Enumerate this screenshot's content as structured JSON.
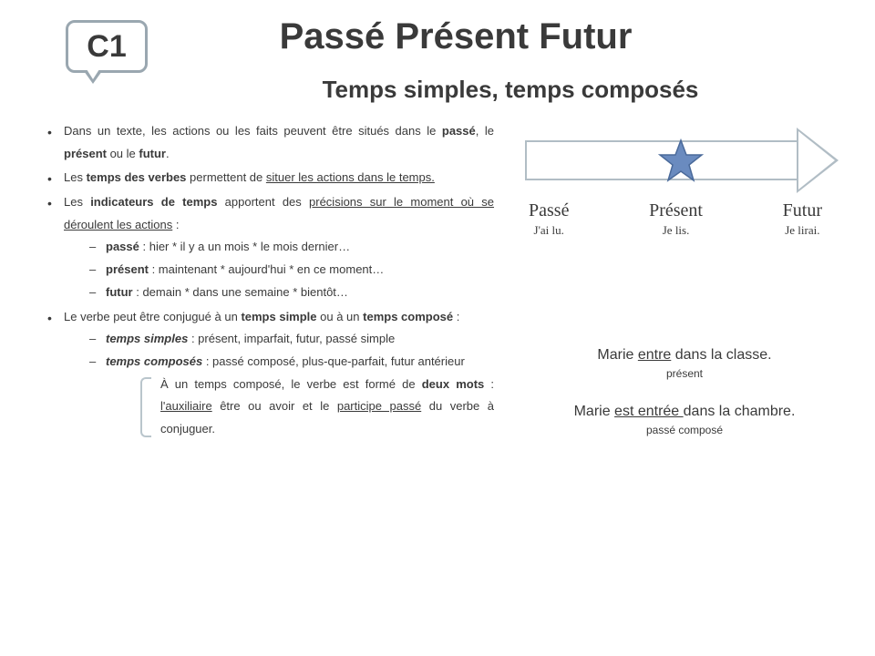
{
  "badge": "C1",
  "title": "Passé Présent Futur",
  "subtitle": "Temps simples, temps composés",
  "bullets": {
    "b1_a": "Dans un texte, les actions ou les faits peuvent être situés dans le ",
    "b1_p": "passé",
    "b1_b": ", le ",
    "b1_pr": "présent",
    "b1_c": " ou le ",
    "b1_f": "futur",
    "b1_d": ".",
    "b2_a": "Les ",
    "b2_t": "temps des verbes",
    "b2_b": " permettent de ",
    "b2_u": "situer les actions dans le temps.",
    "b3_a": "Les ",
    "b3_i": "indicateurs de temps",
    "b3_b": " apportent des ",
    "b3_u": "précisions sur le moment où se déroulent les actions",
    "b3_c": " :",
    "s1_k": "passé",
    "s1_v": " : hier * il y a un mois * le mois dernier…",
    "s2_k": "présent",
    "s2_v": " : maintenant * aujourd'hui * en ce moment…",
    "s3_k": "futur",
    "s3_v": " : demain * dans une semaine * bientôt…",
    "b4_a": "Le verbe peut être conjugué à un ",
    "b4_ts": "temps simple",
    "b4_b": " ou à un ",
    "b4_tc": "temps composé",
    "b4_c": " :",
    "s4_k": "temps simples",
    "s4_v": " : présent, imparfait, futur, passé simple",
    "s5_k": "temps composés",
    "s5_v": " : passé composé, plus-que-parfait, futur antérieur",
    "note_a": "À un temps composé, le verbe est formé de ",
    "note_b": "deux mots",
    "note_c": " : ",
    "note_u1": "l'auxiliaire",
    "note_d": " être ou avoir et le ",
    "note_u2": "participe passé",
    "note_e": " du verbe à conjuguer."
  },
  "timeline": {
    "c1": {
      "h": "Passé",
      "s": "J'ai lu."
    },
    "c2": {
      "h": "Présent",
      "s": "Je lis."
    },
    "c3": {
      "h": "Futur",
      "s": "Je lirai."
    }
  },
  "examples": {
    "l1_a": "Marie ",
    "l1_u": "entre",
    "l1_b": " dans la classe.",
    "t1": "présent",
    "l2_a": "Marie ",
    "l2_u": "est entrée ",
    "l2_b": "dans la chambre.",
    "t2": "passé composé"
  }
}
